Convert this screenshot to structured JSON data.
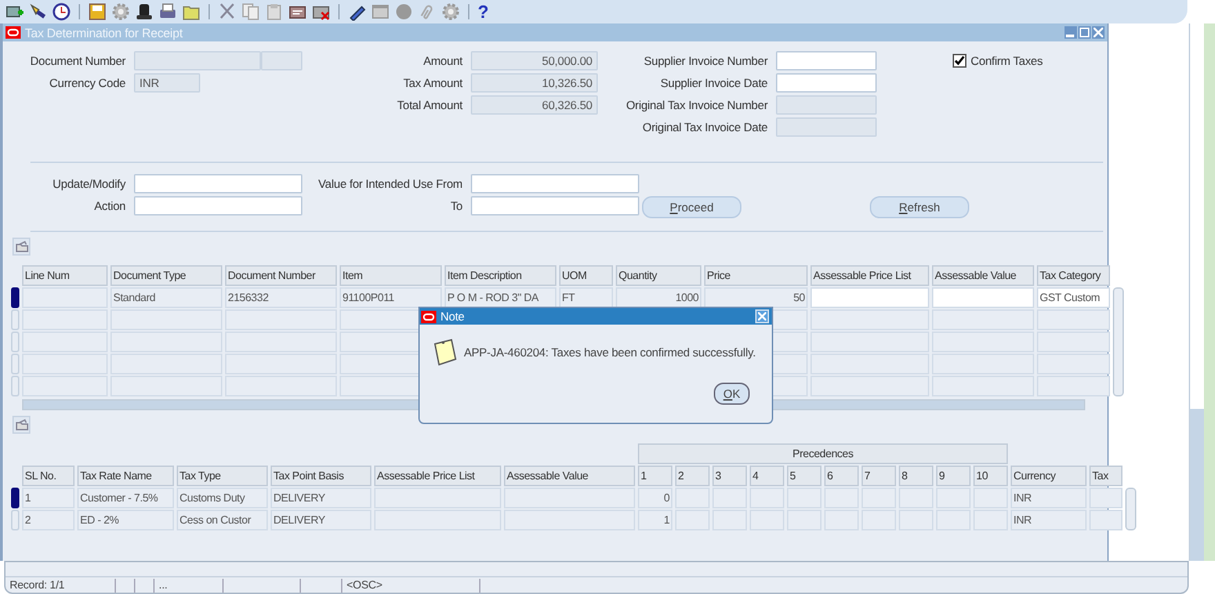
{
  "toolbar": {
    "help": "?"
  },
  "window": {
    "title": "Tax Determination for Receipt"
  },
  "summary": {
    "document": [
      {
        "label": "Document Number",
        "kind": "split",
        "disabled": true
      },
      {
        "label": "Currency Code",
        "kind": "short",
        "value": "INR",
        "disabled": true
      }
    ],
    "amounts": [
      {
        "label": "Amount",
        "value": "50,000.00",
        "disabled": true
      },
      {
        "label": "Tax Amount",
        "value": "10,326.50",
        "disabled": true
      },
      {
        "label": "Total Amount",
        "value": "60,326.50",
        "disabled": true
      }
    ],
    "invoice": [
      {
        "label": "Supplier Invoice Number",
        "disabled": false
      },
      {
        "label": "Supplier Invoice Date",
        "disabled": false
      },
      {
        "label": "Original Tax Invoice Number",
        "disabled": true
      },
      {
        "label": "Original Tax Invoice Date",
        "disabled": true
      }
    ],
    "confirm_taxes": {
      "label": "Confirm Taxes",
      "checked": true
    }
  },
  "filters": {
    "left": [
      {
        "label": "Update/Modify"
      },
      {
        "label": "Action"
      }
    ],
    "right": [
      {
        "label": "Value for Intended Use From"
      },
      {
        "label": "To"
      }
    ],
    "buttons": [
      "Proceed",
      "Refresh"
    ]
  },
  "lines_table": {
    "columns": [
      {
        "label": "Line Num",
        "editable": false
      },
      {
        "label": "Document Type",
        "editable": false
      },
      {
        "label": "Document Number",
        "editable": false
      },
      {
        "label": "Item",
        "editable": false
      },
      {
        "label": "Item Description",
        "editable": false
      },
      {
        "label": "UOM",
        "editable": false
      },
      {
        "label": "Quantity",
        "editable": false
      },
      {
        "label": "Price",
        "editable": false
      },
      {
        "label": "Assessable Price List",
        "editable": true
      },
      {
        "label": "Assessable Value",
        "editable": true
      },
      {
        "label": "Tax Category",
        "editable": true
      }
    ],
    "rows": [
      {
        "selected": true,
        "cells": [
          null,
          "Standard",
          "2156332",
          "91100P011",
          "P O M - ROD 3\" DA",
          "FT",
          "1000",
          "50",
          null,
          null,
          "GST Custom"
        ]
      }
    ]
  },
  "note_dialog": {
    "title": "Note",
    "message": "APP-JA-460204: Taxes have been confirmed successfully.",
    "button": "OK"
  },
  "tax_table": {
    "group_header": "Precedences",
    "columns": [
      "SL No.",
      "Tax Rate Name",
      "Tax Type",
      "Tax Point Basis",
      "Assessable Price List",
      "Assessable Value",
      "1",
      "2",
      "3",
      "4",
      "5",
      "6",
      "7",
      "8",
      "9",
      "10",
      "Currency",
      "Tax"
    ],
    "rows": [
      {
        "selected": true,
        "cells": [
          "1",
          "Customer - 7.5%",
          "Customs Duty",
          "DELIVERY",
          null,
          null,
          "0",
          null,
          null,
          null,
          null,
          null,
          null,
          null,
          null,
          null,
          "INR",
          null
        ]
      },
      {
        "selected": false,
        "cells": [
          "2",
          "ED - 2%",
          "Cess on Custor",
          "DELIVERY",
          null,
          null,
          "1",
          null,
          null,
          null,
          null,
          null,
          null,
          null,
          null,
          null,
          "INR",
          null
        ]
      }
    ]
  },
  "status_bar": {
    "segments": [
      "Record: 1/1",
      "...",
      "<OSC>"
    ]
  }
}
